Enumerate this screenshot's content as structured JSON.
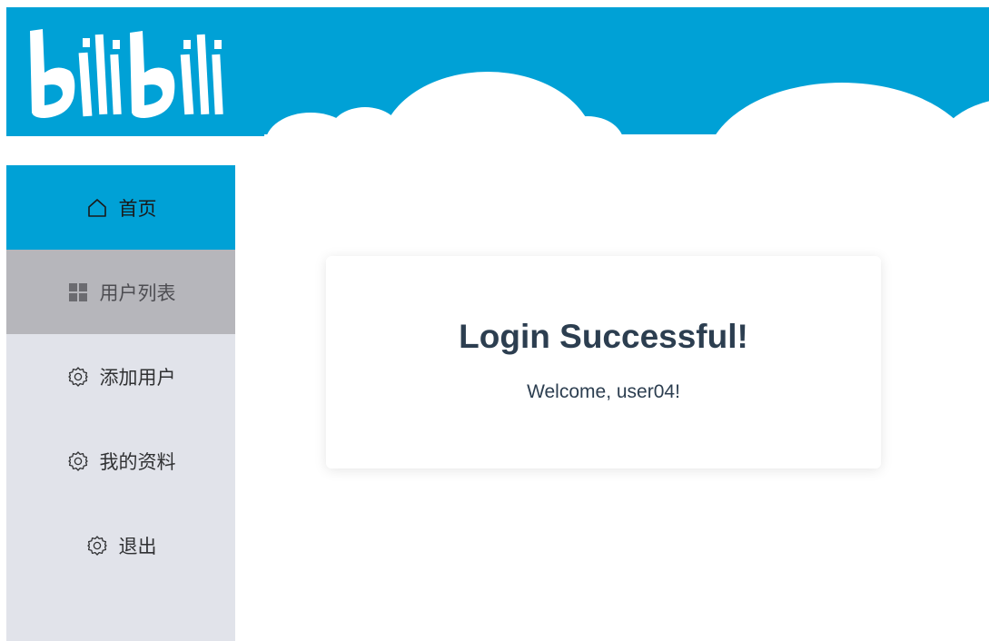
{
  "header": {
    "brand_color": "#00a1d6",
    "logo_text": "bilibili",
    "logo_icon": "bilibili-logo"
  },
  "sidebar": {
    "background": "#e1e3ea",
    "items": [
      {
        "label": "首页",
        "icon": "home-icon",
        "state": "active"
      },
      {
        "label": "用户列表",
        "icon": "grid-icon",
        "state": "hovered"
      },
      {
        "label": "添加用户",
        "icon": "gear-icon",
        "state": "normal"
      },
      {
        "label": "我的资料",
        "icon": "gear-icon",
        "state": "normal"
      },
      {
        "label": "退出",
        "icon": "gear-icon",
        "state": "normal"
      }
    ]
  },
  "main": {
    "card": {
      "title": "Login Successful!",
      "message": "Welcome, user04!"
    }
  }
}
